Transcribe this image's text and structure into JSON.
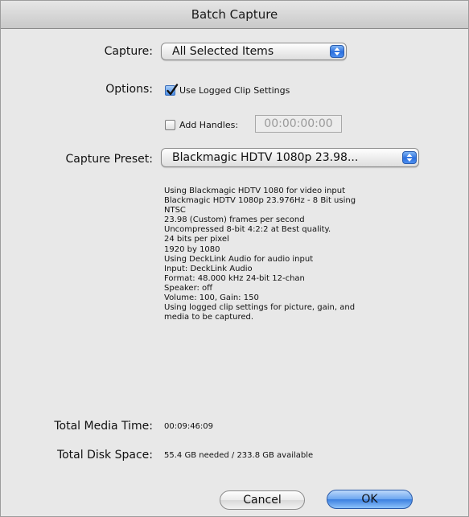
{
  "window": {
    "title": "Batch Capture"
  },
  "capture": {
    "label": "Capture:",
    "selected": "All Selected Items"
  },
  "options": {
    "label": "Options:",
    "use_logged_clip_settings": {
      "label": "Use Logged Clip Settings",
      "checked": true
    },
    "add_handles": {
      "label": "Add Handles:",
      "checked": false,
      "timecode": "00:00:00:00"
    }
  },
  "preset": {
    "label": "Capture Preset:",
    "selected": "Blackmagic HDTV 1080p 23.98..."
  },
  "preset_info": [
    "Using Blackmagic HDTV 1080 for video input",
    "Blackmagic HDTV 1080p 23.976Hz - 8 Bit using",
    "NTSC",
    "23.98 (Custom) frames per second",
    "Uncompressed 8-bit 4:2:2 at Best quality.",
    "24 bits per pixel",
    "1920 by 1080",
    "Using DeckLink Audio for audio input",
    "Input: DeckLink Audio",
    "Format: 48.000 kHz 24-bit 12-chan",
    "Speaker: off",
    "Volume: 100, Gain: 150",
    "Using logged clip settings for picture, gain, and",
    "media to be captured."
  ],
  "totals": {
    "media_time_label": "Total Media Time:",
    "media_time_value": "00:09:46:09",
    "disk_space_label": "Total Disk Space:",
    "disk_space_value": "55.4 GB needed / 233.8 GB available"
  },
  "buttons": {
    "cancel": "Cancel",
    "ok": "OK"
  }
}
